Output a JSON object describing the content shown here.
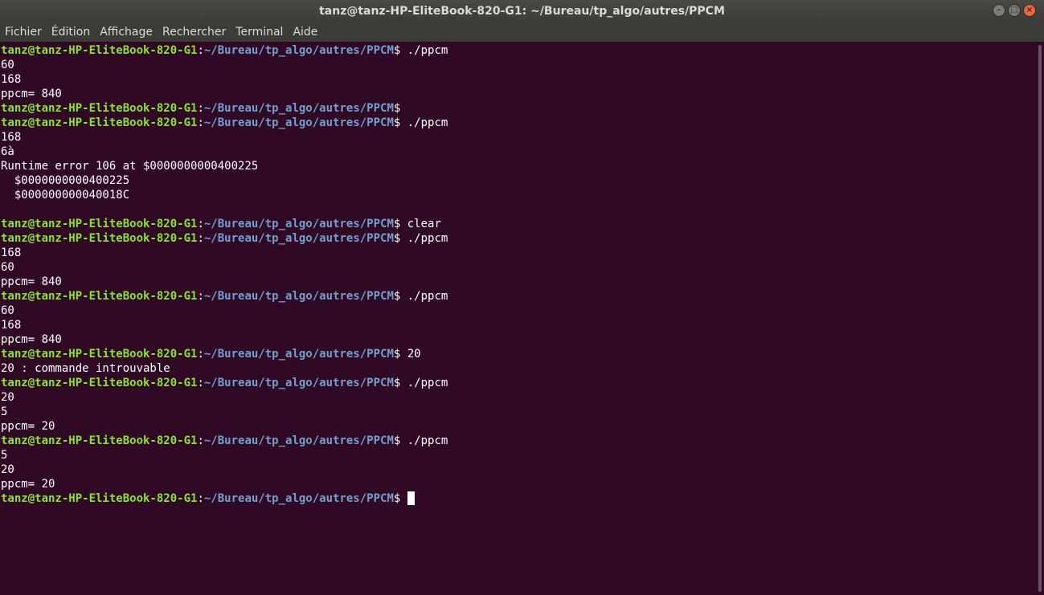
{
  "window": {
    "title": "tanz@tanz-HP-EliteBook-820-G1: ~/Bureau/tp_algo/autres/PPCM",
    "controls": [
      "minimize-icon",
      "maximize-icon",
      "close-icon"
    ]
  },
  "menu": [
    "Fichier",
    "Édition",
    "Affichage",
    "Rechercher",
    "Terminal",
    "Aide"
  ],
  "terminal": {
    "prompt_user": "tanz@tanz-HP-EliteBook-820-G1",
    "prompt_path": "~/Bureau/tp_algo/autres/PPCM",
    "prompt_sep": ":",
    "prompt_end": "$",
    "colors": {
      "background": "#300a24",
      "user": "#8ae234",
      "path": "#729fcf",
      "text": "#ffffff"
    },
    "lines": [
      {
        "type": "prompt",
        "cmd": " ./ppcm"
      },
      {
        "type": "out",
        "text": "60"
      },
      {
        "type": "out",
        "text": "168"
      },
      {
        "type": "out",
        "text": "ppcm= 840"
      },
      {
        "type": "prompt",
        "cmd": ""
      },
      {
        "type": "prompt",
        "cmd": " ./ppcm"
      },
      {
        "type": "out",
        "text": "168"
      },
      {
        "type": "out",
        "text": "6à"
      },
      {
        "type": "out",
        "text": "Runtime error 106 at $0000000000400225"
      },
      {
        "type": "out",
        "text": "  $0000000000400225"
      },
      {
        "type": "out",
        "text": "  $000000000040018C"
      },
      {
        "type": "out",
        "text": ""
      },
      {
        "type": "prompt",
        "cmd": " clear"
      },
      {
        "type": "prompt",
        "cmd": " ./ppcm"
      },
      {
        "type": "out",
        "text": "168"
      },
      {
        "type": "out",
        "text": "60"
      },
      {
        "type": "out",
        "text": "ppcm= 840"
      },
      {
        "type": "prompt",
        "cmd": " ./ppcm"
      },
      {
        "type": "out",
        "text": "60"
      },
      {
        "type": "out",
        "text": "168"
      },
      {
        "type": "out",
        "text": "ppcm= 840"
      },
      {
        "type": "prompt",
        "cmd": " 20"
      },
      {
        "type": "out",
        "text": "20 : commande introuvable"
      },
      {
        "type": "prompt",
        "cmd": " ./ppcm"
      },
      {
        "type": "out",
        "text": "20"
      },
      {
        "type": "out",
        "text": "5"
      },
      {
        "type": "out",
        "text": "ppcm= 20"
      },
      {
        "type": "prompt",
        "cmd": " ./ppcm"
      },
      {
        "type": "out",
        "text": "5"
      },
      {
        "type": "out",
        "text": "20"
      },
      {
        "type": "out",
        "text": "ppcm= 20"
      },
      {
        "type": "prompt",
        "cmd": " ",
        "cursor": true
      }
    ]
  }
}
